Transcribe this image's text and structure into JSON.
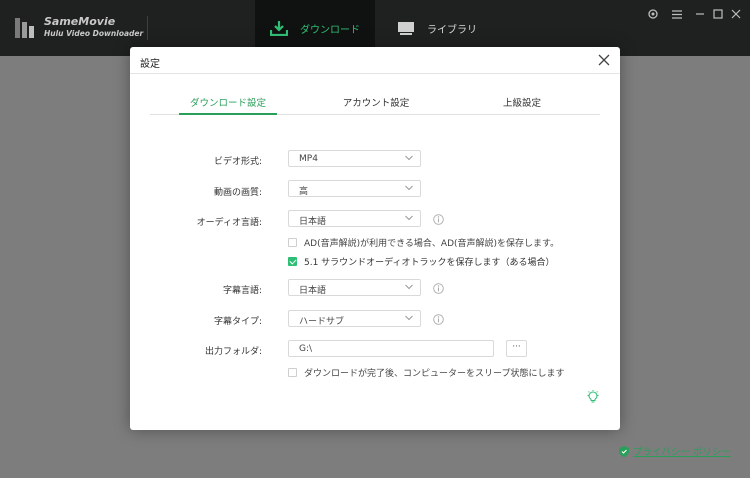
{
  "app": {
    "name": "SameMovie",
    "subtitle": "Hulu Video Downloader"
  },
  "nav": {
    "download": "ダウンロード",
    "library": "ライブラリ"
  },
  "window_controls": [
    "gear-icon",
    "menu-icon",
    "minimize-icon",
    "maximize-icon",
    "close-icon"
  ],
  "dialog": {
    "title": "設定",
    "tabs": [
      "ダウンロード設定",
      "アカウント設定",
      "上級設定"
    ],
    "active_tab": 0,
    "fields": {
      "video_format": {
        "label": "ビデオ形式:",
        "value": "MP4"
      },
      "quality": {
        "label": "動画の画質:",
        "value": "高"
      },
      "audio_lang": {
        "label": "オーディオ言語:",
        "value": "日本語"
      },
      "ad_check": {
        "label": "AD(音声解説)が利用できる場合、AD(音声解説)を保存します。",
        "checked": false
      },
      "surround_check": {
        "label": "5.1 サラウンドオーディオトラックを保存します（ある場合）",
        "checked": true
      },
      "subtitle_lang": {
        "label": "字幕言語:",
        "value": "日本語"
      },
      "subtitle_type": {
        "label": "字幕タイプ:",
        "value": "ハードサブ"
      },
      "output_folder": {
        "label": "出力フォルダ:",
        "value": "G:\\",
        "button": "···"
      },
      "sleep_check": {
        "label": "ダウンロードが完了後、コンピューターをスリープ状態にします",
        "checked": false
      }
    }
  },
  "privacy_link": "プライバシー ポリシー",
  "colors": {
    "accent": "#2a9f5a",
    "topbar": "#1f2120",
    "overlay": "#7d7d7d"
  }
}
